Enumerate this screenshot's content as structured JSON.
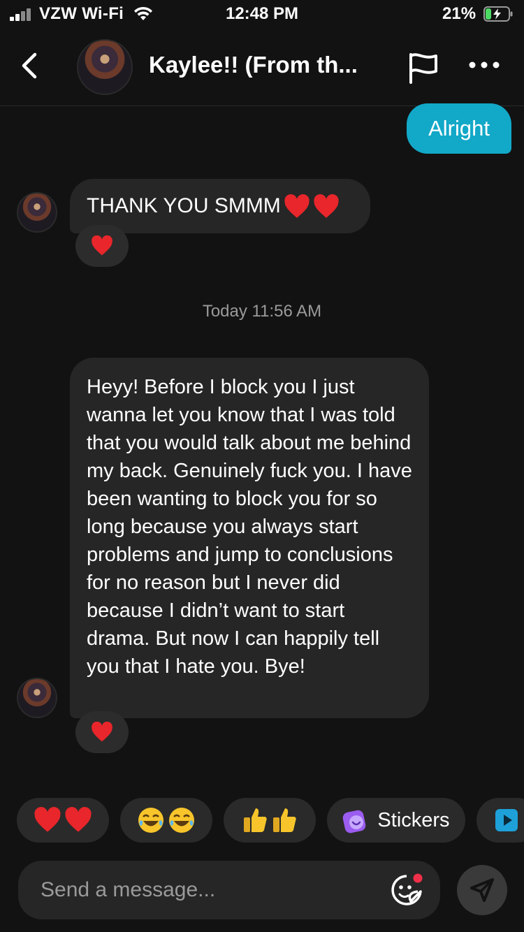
{
  "status": {
    "carrier": "VZW Wi-Fi",
    "time": "12:48 PM",
    "battery_pct": "21%"
  },
  "header": {
    "contact_name": "Kaylee!! (From th..."
  },
  "messages": {
    "outgoing_1": "Alright",
    "incoming_1": "THANK YOU SMMM",
    "timestamp": "Today 11:56 AM",
    "incoming_2": "Heyy! Before I block you I just wanna let you know that I was told that you would talk about me behind my back. Genuinely fuck you. I have been wanting to block you for so long because you always start problems and jump to conclusions for no reason but I never did because I didn’t want to start drama. But now I can happily tell you that I hate you. Bye!"
  },
  "quick_reactions": {
    "stickers_label": "Stickers"
  },
  "composer": {
    "placeholder": "Send a message..."
  },
  "colors": {
    "accent": "#12a8c8",
    "background": "#121212",
    "bubble_in": "#262626",
    "heart": "#e8262b"
  },
  "icons": [
    "back-chevron-icon",
    "flag-icon",
    "more-icon",
    "heart-icon",
    "laughing-emoji-icon",
    "thumbs-up-icon",
    "sticker-icon",
    "play-icon",
    "emoji-face-icon",
    "send-icon"
  ]
}
